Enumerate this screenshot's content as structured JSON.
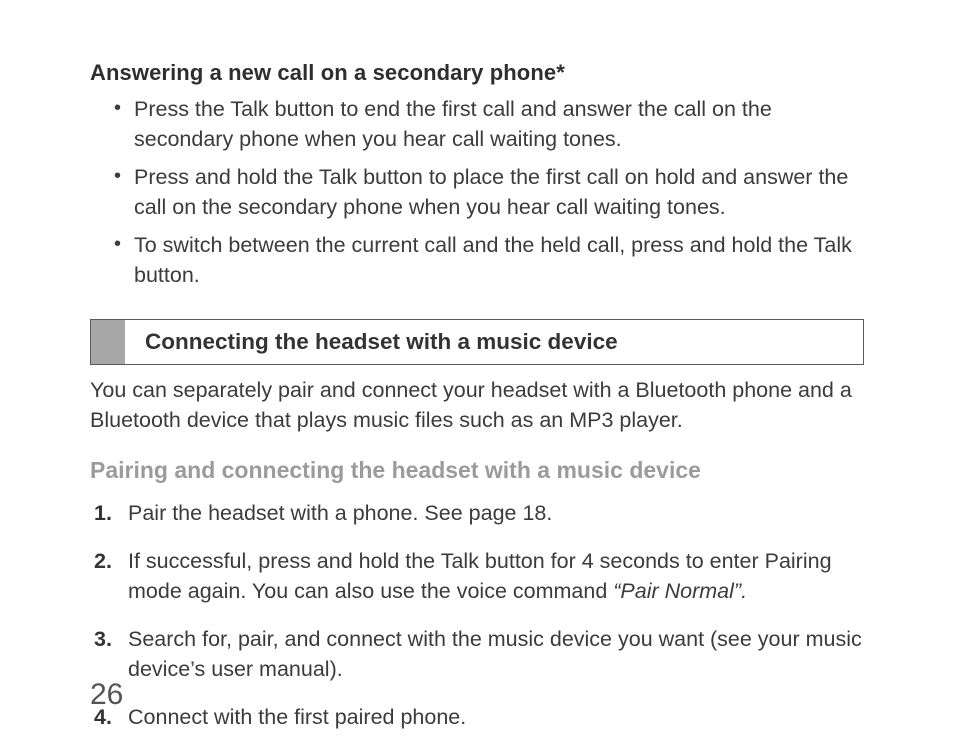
{
  "sectionA": {
    "heading": "Answering a new call on a secondary phone",
    "headingSuffix": "*",
    "items": [
      "Press the Talk button to end the first call and answer the call on the secondary phone when you hear call waiting tones.",
      "Press and hold the Talk button to place the first call on hold and answer the call on the secondary phone when you hear call waiting tones.",
      "To switch between the current call and the held call, press and hold the Talk button."
    ]
  },
  "sectionB": {
    "barLabel": "Connecting the headset with a music device",
    "intro": "You can separately pair and connect your headset with a Bluetooth phone and a Bluetooth device that plays music files such as an MP3 player.",
    "subheading": "Pairing and connecting the headset with a music device",
    "steps": [
      {
        "pre": "Pair the headset with a phone. See page 18.",
        "em": "",
        "post": ""
      },
      {
        "pre": "If successful, press and hold the Talk button for 4 seconds to enter Pairing mode again. You can also use the voice command ",
        "em": "“Pair Normal”.",
        "post": ""
      },
      {
        "pre": "Search for, pair, and connect with the music device you want (see your music device’s user manual).",
        "em": "",
        "post": ""
      },
      {
        "pre": "Connect with the first paired phone.",
        "em": "",
        "post": ""
      }
    ]
  },
  "pageNumber": "26"
}
